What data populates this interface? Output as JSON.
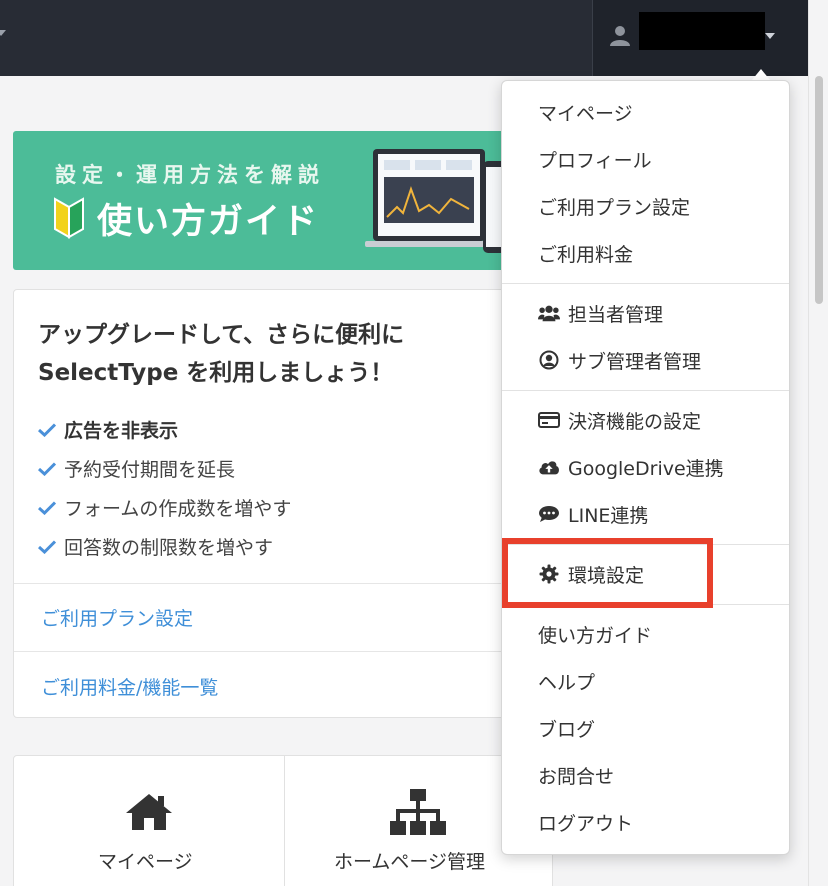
{
  "banner": {
    "subtitle": "設定・運用方法を解説",
    "title": "使い方ガイド"
  },
  "upgrade": {
    "title": "アップグレードして、さらに便利にSelectType を利用しましょう！",
    "features": [
      "広告を非表示",
      "予約受付期間を延長",
      "フォームの作成数を増やす",
      "回答数の制限数を増やす"
    ],
    "links": [
      "ご利用プラン設定",
      "ご利用料金/機能一覧"
    ]
  },
  "tiles": [
    {
      "label": "マイページ",
      "icon": "home-icon"
    },
    {
      "label": "ホームページ管理",
      "icon": "sitemap-icon"
    }
  ],
  "menu": {
    "group1": [
      "マイページ",
      "プロフィール",
      "ご利用プラン設定",
      "ご利用料金"
    ],
    "group2": [
      {
        "label": "担当者管理",
        "icon": "users-icon"
      },
      {
        "label": "サブ管理者管理",
        "icon": "user-circle-icon"
      }
    ],
    "group3": [
      {
        "label": "決済機能の設定",
        "icon": "credit-card-icon"
      },
      {
        "label": "GoogleDrive連携",
        "icon": "cloud-upload-icon"
      },
      {
        "label": "LINE連携",
        "icon": "comment-icon"
      }
    ],
    "group4": [
      {
        "label": "環境設定",
        "icon": "gear-icon"
      }
    ],
    "group5": [
      "使い方ガイド",
      "ヘルプ",
      "ブログ",
      "お問合せ",
      "ログアウト"
    ]
  },
  "colors": {
    "topbar": "#282c35",
    "banner": "#4cbc98",
    "link": "#3f8fd8",
    "check": "#4a90d9",
    "highlight": "#e8402c"
  }
}
